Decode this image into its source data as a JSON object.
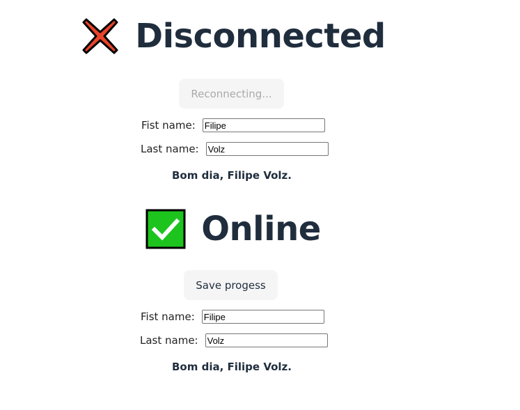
{
  "disconnected": {
    "status_icon": "cross-mark-icon",
    "status_text": "Disconnected",
    "button_label": "Reconnecting...",
    "first_name_label": "Fist name:",
    "first_name_value": "Filipe",
    "last_name_label": "Last name:",
    "last_name_value": "Volz",
    "greeting": "Bom dia, Filipe Volz."
  },
  "online": {
    "status_icon": "check-mark-icon",
    "status_text": "Online",
    "button_label": "Save progess",
    "first_name_label": "Fist name:",
    "first_name_value": "Filipe",
    "last_name_label": "Last name:",
    "last_name_value": "Volz",
    "greeting": "Bom dia, Filipe Volz."
  },
  "colors": {
    "text": "#1f2d3d",
    "cross_fill": "#e8442a",
    "check_fill": "#1ec41e",
    "button_bg": "#f5f5f5"
  }
}
